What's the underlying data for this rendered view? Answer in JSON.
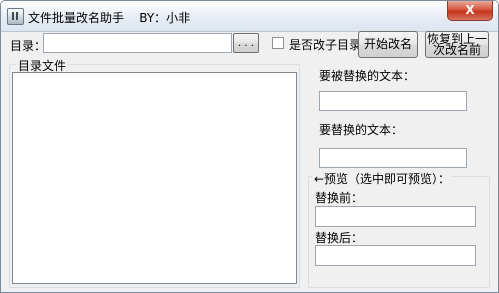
{
  "window": {
    "title": "文件批量改名助手    BY：小非",
    "close_glyph": "X",
    "icon": "app-icon"
  },
  "directory": {
    "label": "目录：",
    "value": "",
    "browse_label": ". . ."
  },
  "options": {
    "rename_subdir_label": "是否改子目录",
    "rename_subdir_checked": false
  },
  "buttons": {
    "start_label": "开始改名",
    "restore_label_line1": "恢复到上一",
    "restore_label_line2": "次改名前"
  },
  "file_list": {
    "group_title": "目录文件",
    "items": []
  },
  "replace": {
    "find_label": "要被替换的文本：",
    "find_value": "",
    "replace_label": "要替换的文本：",
    "replace_value": ""
  },
  "preview": {
    "group_title": "←预览（选中即可预览）：",
    "before_label": "替换前：",
    "before_value": "",
    "after_label": "替换后：",
    "after_value": ""
  }
}
